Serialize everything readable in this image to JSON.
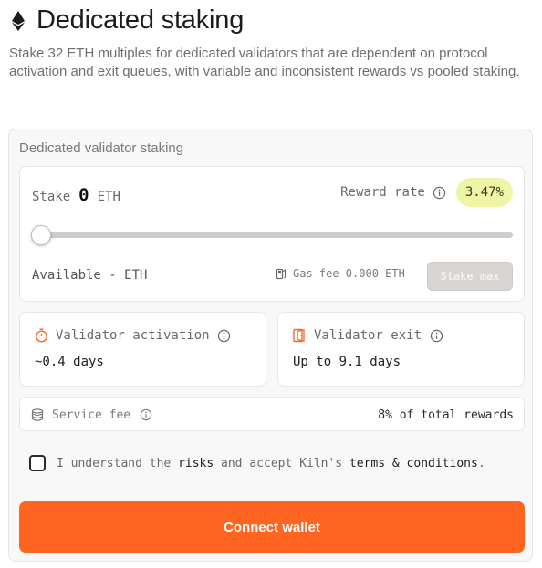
{
  "header": {
    "title": "Dedicated staking",
    "subtitle": "Stake 32 ETH multiples for dedicated validators that are dependent on protocol activation and exit queues, with variable and inconsistent rewards vs pooled staking."
  },
  "card": {
    "title": "Dedicated validator staking",
    "stake": {
      "label": "Stake",
      "value": "0",
      "unit": "ETH",
      "slider_value": 0
    },
    "reward": {
      "label": "Reward rate",
      "rate": "3.47%"
    },
    "available": "Available - ETH",
    "gas_fee": "Gas fee 0.000 ETH",
    "stake_max_label": "Stake max",
    "activation": {
      "label": "Validator activation",
      "value": "~0.4 days"
    },
    "exit": {
      "label": "Validator exit",
      "value": "Up to 9.1 days"
    },
    "service_fee": {
      "label": "Service fee",
      "value": "8% of total rewards"
    },
    "terms": {
      "part1": "I understand the ",
      "risks": "risks",
      "part2": " and accept Kiln's ",
      "conditions": "terms & conditions",
      "end": "."
    },
    "connect_label": "Connect wallet"
  },
  "colors": {
    "accent": "#ff6521",
    "rate_badge": "#eef5a6",
    "activation_icon": "#f26a2e",
    "exit_icon": "#f26a2e"
  },
  "icons": {
    "header": "ethereum-icon",
    "info": "info-icon",
    "gas": "gas-pump-icon",
    "activation": "stopwatch-icon",
    "exit": "door-exit-icon",
    "service_fee": "coins-stack-icon"
  }
}
